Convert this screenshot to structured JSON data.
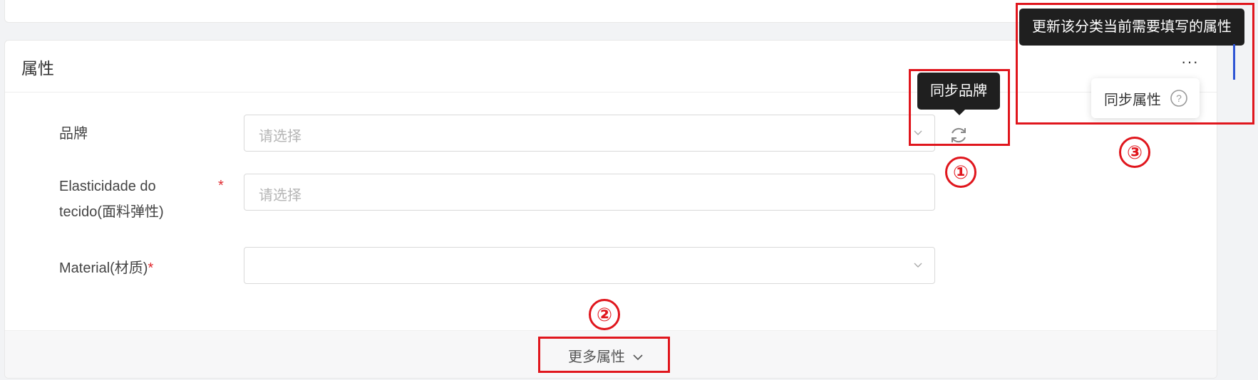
{
  "section": {
    "title": "属性"
  },
  "fields": [
    {
      "label": "品牌",
      "placeholder": "请选择",
      "required": false
    },
    {
      "label_line1": "Elasticidade do",
      "label_line2": "tecido(面料弹性)",
      "placeholder": "请选择",
      "required": true
    },
    {
      "label": "Material(材质)",
      "placeholder": "",
      "required": true
    }
  ],
  "required_mark": "*",
  "tooltips": {
    "sync_brand": "同步品牌",
    "update_attrs": "更新该分类当前需要填写的属性"
  },
  "more_attributes": {
    "label": "更多属性"
  },
  "menu": {
    "more_icon": "ellipsis-icon",
    "sync_attrs_label": "同步属性"
  },
  "annotations": [
    "①",
    "②",
    "③"
  ],
  "colors": {
    "annotation_red": "#e0161d",
    "required_red": "#e0282e",
    "tooltip_bg": "#1f1f1f",
    "accent_blue": "#2f55d4"
  }
}
